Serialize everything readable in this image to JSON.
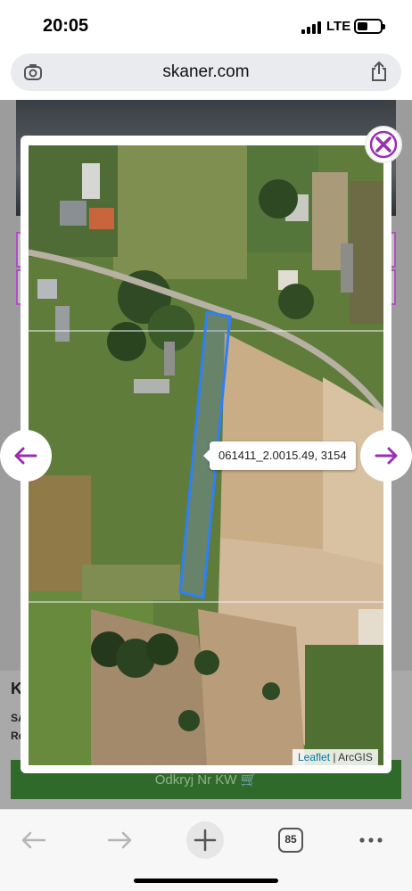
{
  "status_bar": {
    "time": "20:05",
    "network": "LTE",
    "battery_level": 0.45
  },
  "browser": {
    "url": "skaner.com",
    "tab_count": "85"
  },
  "background_page": {
    "card_title": "K",
    "card_line1": "SA",
    "card_line2": "Rc",
    "green_button_label": "Odkryj Nr KW 🛒"
  },
  "map_modal": {
    "tooltip": "061411_2.0015.49, 3154",
    "attribution_leaflet": "Leaflet",
    "attribution_separator": "|",
    "attribution_source": "ArcGIS"
  },
  "colors": {
    "accent": "#9b2fb0",
    "parcel_outline": "#2f7ff5",
    "url_bar": "#e9ebee"
  },
  "icons": {
    "close": "close-icon",
    "prev": "arrow-left-icon",
    "next": "arrow-right-icon",
    "share": "share-icon",
    "back": "back-arrow-icon",
    "forward": "forward-arrow-icon",
    "new_tab": "plus-icon",
    "more": "more-dots-icon"
  }
}
